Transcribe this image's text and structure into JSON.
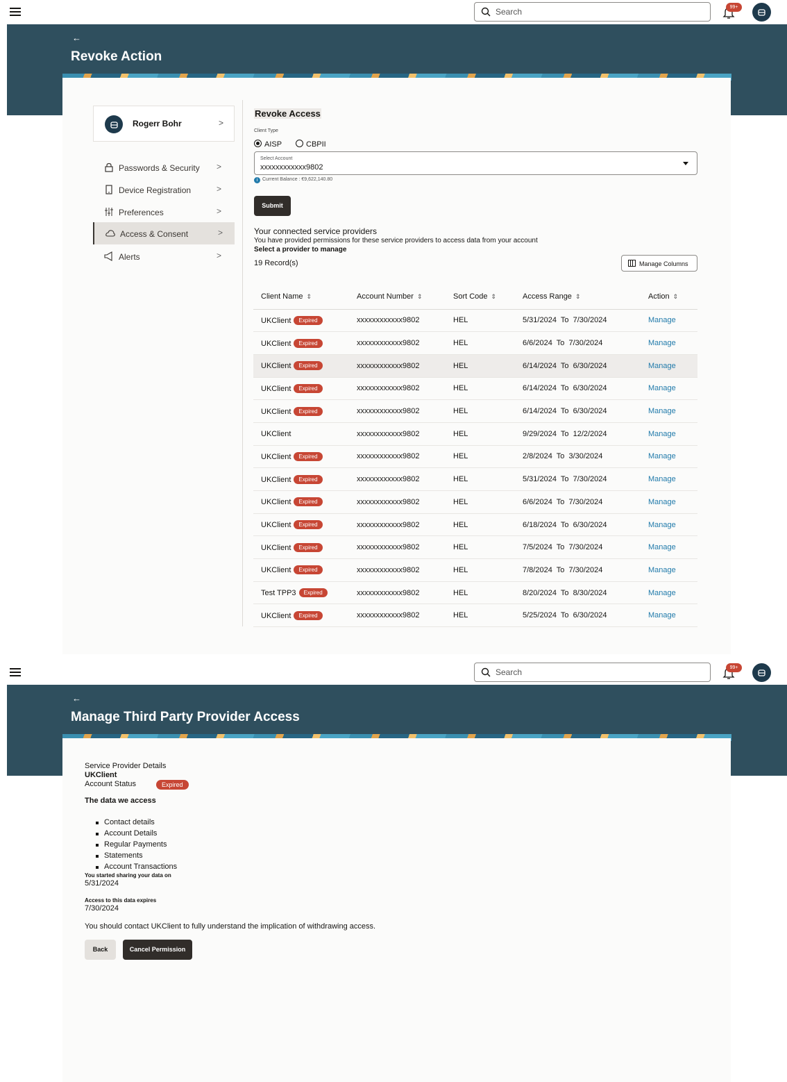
{
  "header": {
    "search_placeholder": "Search",
    "notification_count": "99+"
  },
  "screen1": {
    "back_arrow": "←",
    "title": "Revoke Action",
    "profile": {
      "name": "Rogerr Bohr"
    },
    "sidebar": {
      "items": [
        {
          "label": "Passwords & Security",
          "icon": "lock-icon"
        },
        {
          "label": "Device Registration",
          "icon": "device-icon"
        },
        {
          "label": "Preferences",
          "icon": "sliders-icon"
        },
        {
          "label": "Access & Consent",
          "icon": "cloud-icon",
          "active": true
        },
        {
          "label": "Alerts",
          "icon": "megaphone-icon"
        }
      ]
    },
    "section_title": "Revoke Access",
    "client_type_label": "Client Type",
    "client_types": [
      "AISP",
      "CBPII"
    ],
    "client_type_selected": "AISP",
    "select_account_label": "Select Account",
    "select_account_value": "xxxxxxxxxxxx9802",
    "current_balance": "Current Balance : €9,622,140.80",
    "submit_label": "Submit",
    "providers_heading": "Your connected service providers",
    "providers_desc": "You have provided permissions for these service providers to access data from your account",
    "providers_select": "Select a provider to manage",
    "record_count": "19 Record(s)",
    "manage_columns_label": "Manage Columns",
    "table": {
      "columns": [
        "Client Name",
        "Account Number",
        "Sort Code",
        "Access Range",
        "Action"
      ],
      "expired_label": "Expired",
      "rows": [
        {
          "client": "UKClient",
          "expired": true,
          "account": "xxxxxxxxxxxx9802",
          "sort": "HEL",
          "range": "5/31/2024  To  7/30/2024",
          "action": "Manage"
        },
        {
          "client": "UKClient",
          "expired": true,
          "account": "xxxxxxxxxxxx9802",
          "sort": "HEL",
          "range": "6/6/2024  To  7/30/2024",
          "action": "Manage"
        },
        {
          "client": "UKClient",
          "expired": true,
          "account": "xxxxxxxxxxxx9802",
          "sort": "HEL",
          "range": "6/14/2024  To  6/30/2024",
          "action": "Manage"
        },
        {
          "client": "UKClient",
          "expired": true,
          "account": "xxxxxxxxxxxx9802",
          "sort": "HEL",
          "range": "6/14/2024  To  6/30/2024",
          "action": "Manage"
        },
        {
          "client": "UKClient",
          "expired": true,
          "account": "xxxxxxxxxxxx9802",
          "sort": "HEL",
          "range": "6/14/2024  To  6/30/2024",
          "action": "Manage"
        },
        {
          "client": "UKClient",
          "expired": false,
          "account": "xxxxxxxxxxxx9802",
          "sort": "HEL",
          "range": "9/29/2024  To  12/2/2024",
          "action": "Manage"
        },
        {
          "client": "UKClient",
          "expired": true,
          "account": "xxxxxxxxxxxx9802",
          "sort": "HEL",
          "range": "2/8/2024  To  3/30/2024",
          "action": "Manage"
        },
        {
          "client": "UKClient",
          "expired": true,
          "account": "xxxxxxxxxxxx9802",
          "sort": "HEL",
          "range": "5/31/2024  To  7/30/2024",
          "action": "Manage"
        },
        {
          "client": "UKClient",
          "expired": true,
          "account": "xxxxxxxxxxxx9802",
          "sort": "HEL",
          "range": "6/6/2024  To  7/30/2024",
          "action": "Manage"
        },
        {
          "client": "UKClient",
          "expired": true,
          "account": "xxxxxxxxxxxx9802",
          "sort": "HEL",
          "range": "6/18/2024  To  6/30/2024",
          "action": "Manage"
        },
        {
          "client": "UKClient",
          "expired": true,
          "account": "xxxxxxxxxxxx9802",
          "sort": "HEL",
          "range": "7/5/2024  To  7/30/2024",
          "action": "Manage"
        },
        {
          "client": "UKClient",
          "expired": true,
          "account": "xxxxxxxxxxxx9802",
          "sort": "HEL",
          "range": "7/8/2024  To  7/30/2024",
          "action": "Manage"
        },
        {
          "client": "Test TPP3",
          "expired": true,
          "account": "xxxxxxxxxxxx9802",
          "sort": "HEL",
          "range": "8/20/2024  To  8/30/2024",
          "action": "Manage"
        },
        {
          "client": "UKClient",
          "expired": true,
          "account": "xxxxxxxxxxxx9802",
          "sort": "HEL",
          "range": "5/25/2024  To  6/30/2024",
          "action": "Manage"
        }
      ]
    }
  },
  "screen2": {
    "back_arrow": "←",
    "title": "Manage Third Party Provider Access",
    "details_label": "Service Provider Details",
    "provider_name": "UKClient",
    "account_status_label": "Account Status",
    "account_status_value": "Expired",
    "data_heading": "The data we access",
    "data_items": [
      "Contact details",
      "Account Details",
      "Regular Payments",
      "Statements",
      "Account Transactions"
    ],
    "started_label": "You started sharing your data on",
    "started_value": "5/31/2024",
    "expires_label": "Access to this data expires",
    "expires_value": "7/30/2024",
    "note": "You should contact UKClient to fully understand the implication of withdrawing access.",
    "back_label": "Back",
    "cancel_label": "Cancel Permission"
  },
  "colors": {
    "banner": "#2f4f5e",
    "accent_dark": "#312d2a",
    "expired_badge": "#c74634",
    "link": "#227bab"
  }
}
